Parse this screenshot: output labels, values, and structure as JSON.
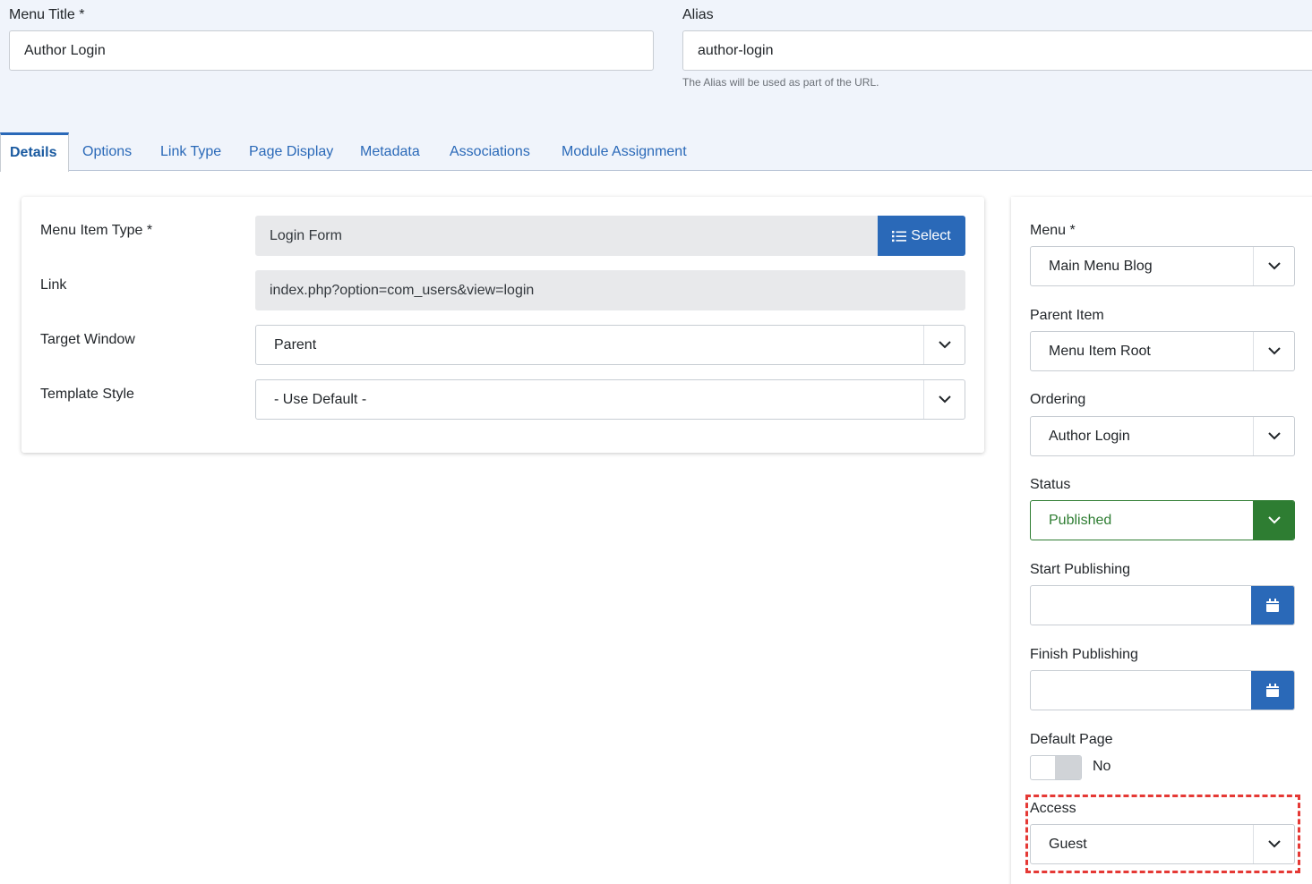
{
  "header": {
    "menu_title_label": "Menu Title *",
    "menu_title_value": "Author Login",
    "alias_label": "Alias",
    "alias_value": "author-login",
    "alias_hint": "The Alias will be used as part of the URL."
  },
  "tabs": [
    {
      "label": "Details",
      "active": true
    },
    {
      "label": "Options"
    },
    {
      "label": "Link Type"
    },
    {
      "label": "Page Display"
    },
    {
      "label": "Metadata"
    },
    {
      "label": "Associations"
    },
    {
      "label": "Module Assignment"
    }
  ],
  "details": {
    "menu_item_type_label": "Menu Item Type *",
    "menu_item_type_value": "Login Form",
    "select_button_label": "Select",
    "link_label": "Link",
    "link_value": "index.php?option=com_users&view=login",
    "target_window_label": "Target Window",
    "target_window_value": "Parent",
    "template_style_label": "Template Style",
    "template_style_value": "- Use Default -"
  },
  "sidebar": {
    "menu_label": "Menu *",
    "menu_value": "Main Menu Blog",
    "parent_item_label": "Parent Item",
    "parent_item_value": "Menu Item Root",
    "ordering_label": "Ordering",
    "ordering_value": "Author Login",
    "status_label": "Status",
    "status_value": "Published",
    "start_publishing_label": "Start Publishing",
    "start_publishing_value": "",
    "finish_publishing_label": "Finish Publishing",
    "finish_publishing_value": "",
    "default_page_label": "Default Page",
    "default_page_value": "No",
    "access_label": "Access",
    "access_value": "Guest"
  },
  "colors": {
    "accent": "#2a69b8",
    "published": "#2e7d32",
    "highlight": "#e53935"
  }
}
